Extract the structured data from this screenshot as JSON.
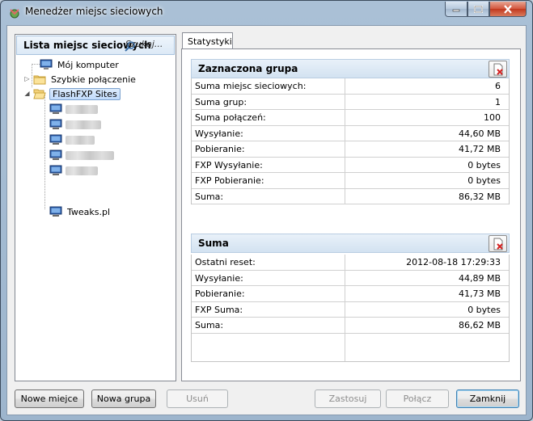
{
  "window": {
    "title": "Menedżer miejsc sieciowych"
  },
  "left_panel": {
    "title": "Lista miejsc sieciowych",
    "search_hint": "Szukaj..."
  },
  "tree": {
    "items": [
      {
        "label": "Mój komputer",
        "icon": "computer-icon"
      },
      {
        "label": "Szybkie połączenie",
        "icon": "folder-icon"
      },
      {
        "label": "FlashFXP Sites",
        "icon": "folder-open-icon",
        "selected": true
      },
      {
        "label": "Tweaks.pl",
        "icon": "site-icon"
      }
    ],
    "blurred_sites": [
      {
        "icon": "site-icon"
      },
      {
        "icon": "site-icon"
      },
      {
        "icon": "site-icon"
      },
      {
        "icon": "site-icon"
      },
      {
        "icon": "site-icon"
      }
    ]
  },
  "tabs": {
    "statistics": "Statystyki"
  },
  "group_section": {
    "title": "Zaznaczona grupa",
    "rows": [
      {
        "label": "Suma miejsc sieciowych:",
        "value": "6"
      },
      {
        "label": "Suma grup:",
        "value": "1"
      },
      {
        "label": "Suma połączeń:",
        "value": "100"
      },
      {
        "label": "Wysyłanie:",
        "value": "44,60 MB"
      },
      {
        "label": "Pobieranie:",
        "value": "41,72 MB"
      },
      {
        "label": "FXP Wysyłanie:",
        "value": "0 bytes"
      },
      {
        "label": "FXP Pobieranie:",
        "value": "0 bytes"
      },
      {
        "label": "Suma:",
        "value": "86,32 MB"
      }
    ]
  },
  "total_section": {
    "title": "Suma",
    "rows": [
      {
        "label": "Ostatni reset:",
        "value": "2012-08-18 17:29:33"
      },
      {
        "label": "Wysyłanie:",
        "value": "44,89 MB"
      },
      {
        "label": "Pobieranie:",
        "value": "41,73 MB"
      },
      {
        "label": "FXP Suma:",
        "value": "0 bytes"
      },
      {
        "label": "Suma:",
        "value": "86,62 MB"
      }
    ]
  },
  "buttons": {
    "new_site": "Nowe miejce",
    "new_group": "Nowa grupa",
    "delete": "Usuń",
    "apply": "Zastosuj",
    "connect": "Połącz",
    "close": "Zamknij"
  },
  "colors": {
    "selection": "#c1dbfc",
    "header": "#d3e2f1",
    "close_button": "#c2391f"
  }
}
